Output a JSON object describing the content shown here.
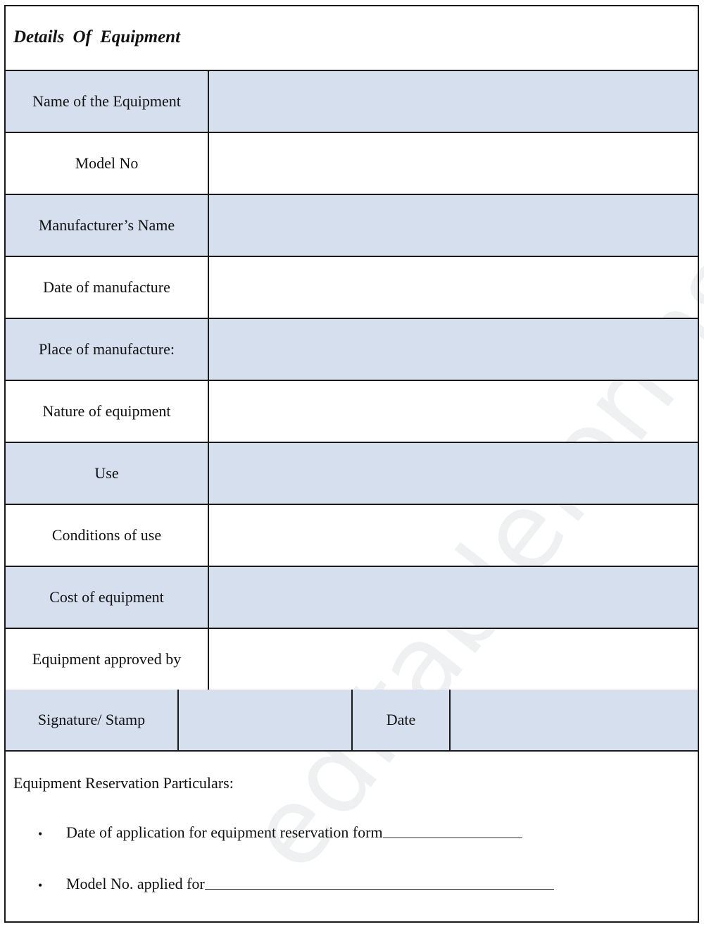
{
  "form": {
    "title": "Details  Of  Equipment",
    "rows": [
      {
        "label": "Name of the Equipment",
        "value": ""
      },
      {
        "label": "Model No",
        "value": ""
      },
      {
        "label": "Manufacturer’s Name",
        "value": ""
      },
      {
        "label": "Date of manufacture",
        "value": ""
      },
      {
        "label": "Place of manufacture:",
        "value": ""
      },
      {
        "label": "Nature of equipment",
        "value": ""
      },
      {
        "label": "Use",
        "value": ""
      },
      {
        "label": "Conditions of use",
        "value": ""
      },
      {
        "label": "Cost of equipment",
        "value": ""
      },
      {
        "label": "Equipment approved by",
        "value": ""
      }
    ],
    "signature_row": {
      "signature_label": "Signature/ Stamp",
      "signature_value": "",
      "date_label": "Date",
      "date_value": ""
    },
    "reservation": {
      "heading": "Equipment Reservation Particulars:",
      "items": [
        {
          "bullet": "•",
          "label": "Date of application for equipment reservation form",
          "value": ""
        },
        {
          "bullet": "•",
          "label": "Model No. applied for",
          "value": ""
        }
      ]
    },
    "shaded_color": "#d5dfee"
  },
  "watermark": "editableforms.com"
}
